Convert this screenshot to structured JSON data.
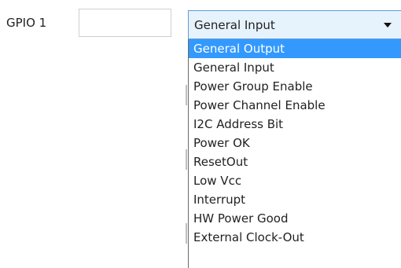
{
  "form": {
    "gpio_label": "GPIO 1",
    "gpio_input_value": "",
    "select": {
      "selected_value": "General Input",
      "icon": "chevron-down-icon"
    },
    "dropdown": {
      "highlighted_index": 0,
      "options": [
        "General Output",
        "General Input",
        "Power Group Enable",
        "Power Channel Enable",
        "I2C Address Bit",
        "Power OK",
        "ResetOut",
        "Low Vcc",
        "Interrupt",
        "HW Power Good",
        "External Clock-Out"
      ]
    }
  },
  "colors": {
    "highlight": "#3399ff",
    "select_background": "#e6f2fc",
    "select_border": "#5c9ed6"
  }
}
